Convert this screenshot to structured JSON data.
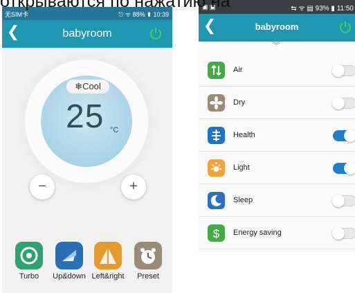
{
  "caption": "открываются по нажатию на",
  "phone1": {
    "status_left": "无SIM卡",
    "status_right": "⎋ ᯤ 88% ▮ 10:39",
    "title": "babyroom",
    "mode": "❄Cool",
    "temperature": "25",
    "unit": "°C",
    "minus": "−",
    "plus": "+",
    "functions": [
      {
        "label": "Turbo",
        "icon": "turbo-icon",
        "color": "#2fa36f"
      },
      {
        "label": "Up&down",
        "icon": "updown-swing-icon",
        "color": "#2a6fb6"
      },
      {
        "label": "Left&right",
        "icon": "leftright-swing-icon",
        "color": "#e59a2b"
      },
      {
        "label": "Preset",
        "icon": "alarm-clock-icon",
        "color": "#9a8a78"
      }
    ]
  },
  "phone2": {
    "status_left": "▣ ▣",
    "status_right": "⇆ ᯤ ▤ 93% ▮ 11:50",
    "title": "babyroom",
    "rows": [
      {
        "label": "Air",
        "icon": "air-icon",
        "color": "#48a848",
        "on": false
      },
      {
        "label": "Dry",
        "icon": "dry-icon",
        "color": "#9a8a78",
        "on": false
      },
      {
        "label": "Health",
        "icon": "health-icon",
        "color": "#1f73c7",
        "on": true
      },
      {
        "label": "Light",
        "icon": "light-icon",
        "color": "#f2a23a",
        "on": true
      },
      {
        "label": "Sleep",
        "icon": "sleep-icon",
        "color": "#2a6fc0",
        "on": false
      },
      {
        "label": "Energy saving",
        "icon": "energy-saving-icon",
        "color": "#46a846",
        "on": false
      }
    ]
  }
}
